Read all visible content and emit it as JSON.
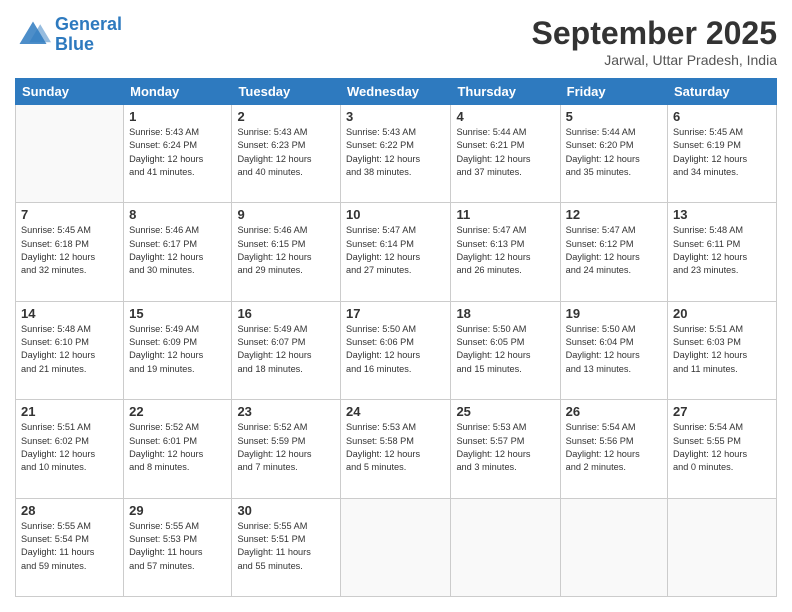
{
  "header": {
    "logo_line1": "General",
    "logo_line2": "Blue",
    "month": "September 2025",
    "location": "Jarwal, Uttar Pradesh, India"
  },
  "weekdays": [
    "Sunday",
    "Monday",
    "Tuesday",
    "Wednesday",
    "Thursday",
    "Friday",
    "Saturday"
  ],
  "weeks": [
    [
      {
        "day": "",
        "info": ""
      },
      {
        "day": "1",
        "info": "Sunrise: 5:43 AM\nSunset: 6:24 PM\nDaylight: 12 hours\nand 41 minutes."
      },
      {
        "day": "2",
        "info": "Sunrise: 5:43 AM\nSunset: 6:23 PM\nDaylight: 12 hours\nand 40 minutes."
      },
      {
        "day": "3",
        "info": "Sunrise: 5:43 AM\nSunset: 6:22 PM\nDaylight: 12 hours\nand 38 minutes."
      },
      {
        "day": "4",
        "info": "Sunrise: 5:44 AM\nSunset: 6:21 PM\nDaylight: 12 hours\nand 37 minutes."
      },
      {
        "day": "5",
        "info": "Sunrise: 5:44 AM\nSunset: 6:20 PM\nDaylight: 12 hours\nand 35 minutes."
      },
      {
        "day": "6",
        "info": "Sunrise: 5:45 AM\nSunset: 6:19 PM\nDaylight: 12 hours\nand 34 minutes."
      }
    ],
    [
      {
        "day": "7",
        "info": "Sunrise: 5:45 AM\nSunset: 6:18 PM\nDaylight: 12 hours\nand 32 minutes."
      },
      {
        "day": "8",
        "info": "Sunrise: 5:46 AM\nSunset: 6:17 PM\nDaylight: 12 hours\nand 30 minutes."
      },
      {
        "day": "9",
        "info": "Sunrise: 5:46 AM\nSunset: 6:15 PM\nDaylight: 12 hours\nand 29 minutes."
      },
      {
        "day": "10",
        "info": "Sunrise: 5:47 AM\nSunset: 6:14 PM\nDaylight: 12 hours\nand 27 minutes."
      },
      {
        "day": "11",
        "info": "Sunrise: 5:47 AM\nSunset: 6:13 PM\nDaylight: 12 hours\nand 26 minutes."
      },
      {
        "day": "12",
        "info": "Sunrise: 5:47 AM\nSunset: 6:12 PM\nDaylight: 12 hours\nand 24 minutes."
      },
      {
        "day": "13",
        "info": "Sunrise: 5:48 AM\nSunset: 6:11 PM\nDaylight: 12 hours\nand 23 minutes."
      }
    ],
    [
      {
        "day": "14",
        "info": "Sunrise: 5:48 AM\nSunset: 6:10 PM\nDaylight: 12 hours\nand 21 minutes."
      },
      {
        "day": "15",
        "info": "Sunrise: 5:49 AM\nSunset: 6:09 PM\nDaylight: 12 hours\nand 19 minutes."
      },
      {
        "day": "16",
        "info": "Sunrise: 5:49 AM\nSunset: 6:07 PM\nDaylight: 12 hours\nand 18 minutes."
      },
      {
        "day": "17",
        "info": "Sunrise: 5:50 AM\nSunset: 6:06 PM\nDaylight: 12 hours\nand 16 minutes."
      },
      {
        "day": "18",
        "info": "Sunrise: 5:50 AM\nSunset: 6:05 PM\nDaylight: 12 hours\nand 15 minutes."
      },
      {
        "day": "19",
        "info": "Sunrise: 5:50 AM\nSunset: 6:04 PM\nDaylight: 12 hours\nand 13 minutes."
      },
      {
        "day": "20",
        "info": "Sunrise: 5:51 AM\nSunset: 6:03 PM\nDaylight: 12 hours\nand 11 minutes."
      }
    ],
    [
      {
        "day": "21",
        "info": "Sunrise: 5:51 AM\nSunset: 6:02 PM\nDaylight: 12 hours\nand 10 minutes."
      },
      {
        "day": "22",
        "info": "Sunrise: 5:52 AM\nSunset: 6:01 PM\nDaylight: 12 hours\nand 8 minutes."
      },
      {
        "day": "23",
        "info": "Sunrise: 5:52 AM\nSunset: 5:59 PM\nDaylight: 12 hours\nand 7 minutes."
      },
      {
        "day": "24",
        "info": "Sunrise: 5:53 AM\nSunset: 5:58 PM\nDaylight: 12 hours\nand 5 minutes."
      },
      {
        "day": "25",
        "info": "Sunrise: 5:53 AM\nSunset: 5:57 PM\nDaylight: 12 hours\nand 3 minutes."
      },
      {
        "day": "26",
        "info": "Sunrise: 5:54 AM\nSunset: 5:56 PM\nDaylight: 12 hours\nand 2 minutes."
      },
      {
        "day": "27",
        "info": "Sunrise: 5:54 AM\nSunset: 5:55 PM\nDaylight: 12 hours\nand 0 minutes."
      }
    ],
    [
      {
        "day": "28",
        "info": "Sunrise: 5:55 AM\nSunset: 5:54 PM\nDaylight: 11 hours\nand 59 minutes."
      },
      {
        "day": "29",
        "info": "Sunrise: 5:55 AM\nSunset: 5:53 PM\nDaylight: 11 hours\nand 57 minutes."
      },
      {
        "day": "30",
        "info": "Sunrise: 5:55 AM\nSunset: 5:51 PM\nDaylight: 11 hours\nand 55 minutes."
      },
      {
        "day": "",
        "info": ""
      },
      {
        "day": "",
        "info": ""
      },
      {
        "day": "",
        "info": ""
      },
      {
        "day": "",
        "info": ""
      }
    ]
  ]
}
